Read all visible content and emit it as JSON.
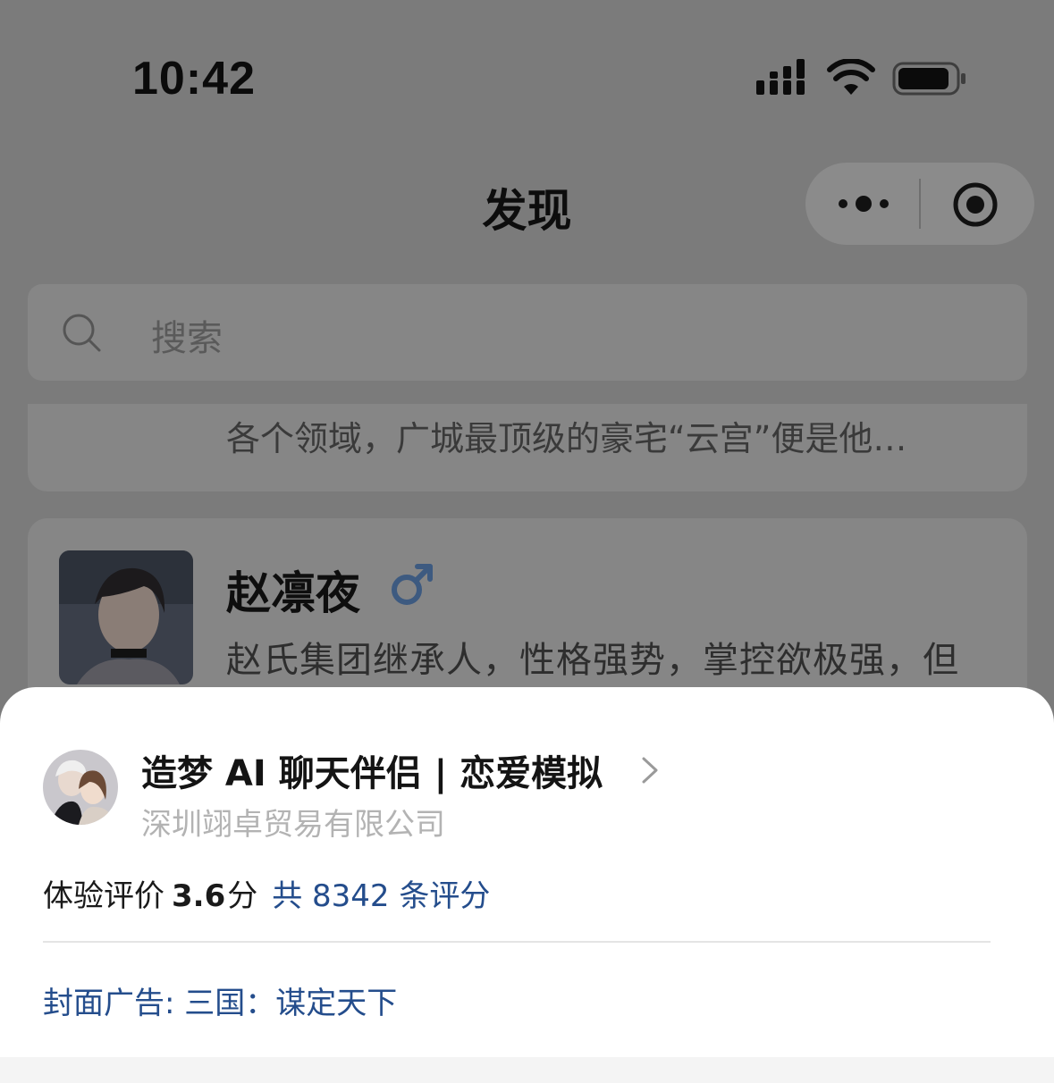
{
  "status_bar": {
    "time": "10:42"
  },
  "nav": {
    "title": "发现"
  },
  "search": {
    "placeholder": "搜索"
  },
  "cards": [
    {
      "description": "各个领域，广城最顶级的豪宅“云宫”便是他…"
    },
    {
      "name": "赵凛夜",
      "gender_icon": "male-icon",
      "description": "赵氏集团继承人，性格强势，掌控欲极强，但"
    }
  ],
  "sheet": {
    "app_name": "造梦 AI 聊天伴侣 | 恋爱模拟",
    "company": "深圳翊卓贸易有限公司",
    "rating_label": "体验评价",
    "rating_score": "3.6",
    "rating_unit": "分",
    "rating_count": "共 8342 条评分",
    "ad": "封面广告: 三国：谋定天下"
  },
  "colors": {
    "link_blue": "#244d8c",
    "overlay_gray": "#7b7b7b",
    "gender_blue": "#3d5a80"
  }
}
